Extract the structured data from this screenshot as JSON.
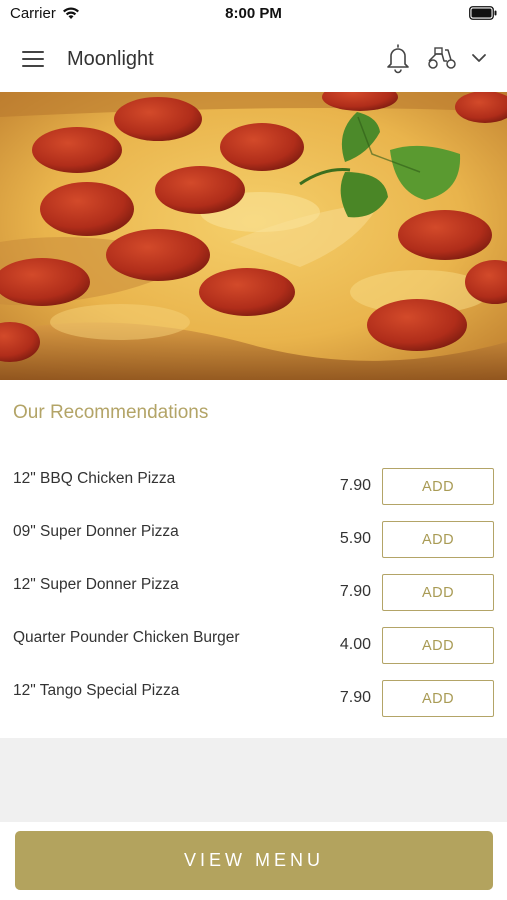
{
  "status_bar": {
    "carrier": "Carrier",
    "time": "8:00 PM"
  },
  "header": {
    "title": "Moonlight",
    "icons": [
      "menu-icon",
      "bell-icon",
      "scooter-icon",
      "chevron-down-icon"
    ]
  },
  "hero": {
    "image": "pepperoni-pizza-with-basil"
  },
  "recommendations": {
    "title": "Our Recommendations",
    "items": [
      {
        "name": "12\" BBQ Chicken Pizza",
        "price": "7.90",
        "button": "ADD"
      },
      {
        "name": "09\" Super Donner Pizza",
        "price": "5.90",
        "button": "ADD"
      },
      {
        "name": "12\" Super Donner Pizza",
        "price": "7.90",
        "button": "ADD"
      },
      {
        "name": "Quarter Pounder Chicken Burger",
        "price": "4.00",
        "button": "ADD"
      },
      {
        "name": "12\" Tango Special Pizza",
        "price": "7.90",
        "button": "ADD"
      }
    ]
  },
  "footer": {
    "view_menu_label": "VIEW MENU"
  },
  "colors": {
    "accent": "#b3a35e",
    "accent_text": "#b3a467",
    "background": "#ffffff",
    "band": "#f0f0f0"
  }
}
